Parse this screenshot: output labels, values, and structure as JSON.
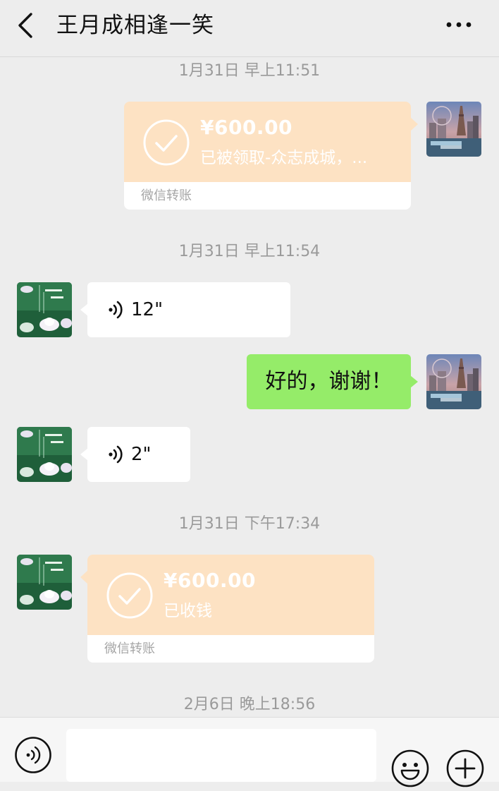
{
  "header": {
    "title": "王月成相逢一笑",
    "back_icon": "chevron-left-icon",
    "more_icon": "more-dots-icon"
  },
  "messages": [
    {
      "type": "timestamp",
      "text": "1月31日 早上11:51"
    },
    {
      "type": "transfer",
      "side": "right",
      "amount": "¥600.00",
      "status": "已被领取-众志成城，...",
      "footer": "微信转账"
    },
    {
      "type": "timestamp",
      "text": "1月31日 早上11:54"
    },
    {
      "type": "voice",
      "side": "left",
      "duration": "12\""
    },
    {
      "type": "text",
      "side": "right",
      "text": "好的，谢谢！"
    },
    {
      "type": "voice",
      "side": "left",
      "duration": "2\""
    },
    {
      "type": "timestamp",
      "text": "1月31日 下午17:34"
    },
    {
      "type": "transfer",
      "side": "left",
      "amount": "¥600.00",
      "status": "已收钱",
      "footer": "微信转账"
    },
    {
      "type": "timestamp",
      "text": "2月6日 晚上18:56"
    }
  ],
  "input_bar": {
    "placeholder": "",
    "voice_icon": "voice-input-icon",
    "emoji_icon": "emoji-icon",
    "plus_icon": "plus-icon"
  },
  "colors": {
    "background": "#ededed",
    "transfer_orange": "#fde2c3",
    "sent_green": "#95ec69",
    "received_white": "#ffffff",
    "timestamp_gray": "#9a9a9a"
  }
}
